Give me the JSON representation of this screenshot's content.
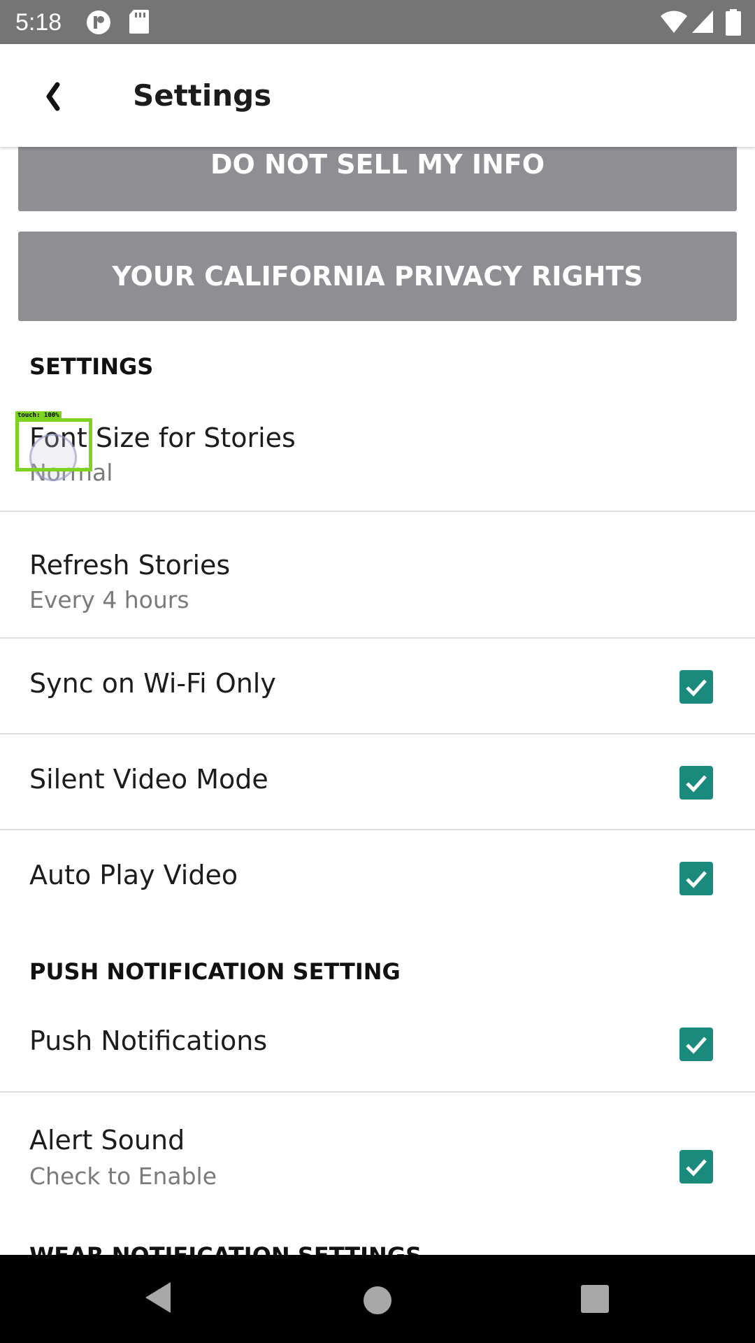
{
  "status_bar": {
    "time": "5:18",
    "left_icons": [
      "cast-icon",
      "sd-card-icon"
    ],
    "right_icons": [
      "wifi-icon",
      "signal-icon",
      "battery-icon"
    ]
  },
  "app_bar": {
    "title": "Settings",
    "back_icon": "back-chevron-icon"
  },
  "buttons": {
    "do_not_sell": "DO NOT SELL MY INFO",
    "ccpa": "YOUR CALIFORNIA PRIVACY RIGHTS"
  },
  "sections": {
    "settings_header": "SETTINGS",
    "push_header": "PUSH NOTIFICATION SETTING",
    "wear_header": "WEAR NOTIFICATION SETTINGS"
  },
  "rows": {
    "font_size": {
      "title": "Font Size for Stories",
      "value": "Normal"
    },
    "refresh": {
      "title": "Refresh Stories",
      "value": "Every 4 hours"
    },
    "sync_wifi": {
      "title": "Sync on Wi-Fi Only",
      "checked": true
    },
    "silent_video": {
      "title": "Silent Video Mode",
      "checked": true
    },
    "auto_play": {
      "title": "Auto Play Video",
      "checked": true
    },
    "push_notifications": {
      "title": "Push Notifications",
      "checked": true
    },
    "alert_sound": {
      "title": "Alert Sound",
      "subtitle": "Check to Enable",
      "checked": true
    }
  },
  "touch_overlay": {
    "label": "touch: 100%"
  },
  "colors": {
    "status_bar": "#757575",
    "gray_button": "#8e8e93",
    "checkbox": "#1a8a7d",
    "touch_box": "#7ed321"
  }
}
